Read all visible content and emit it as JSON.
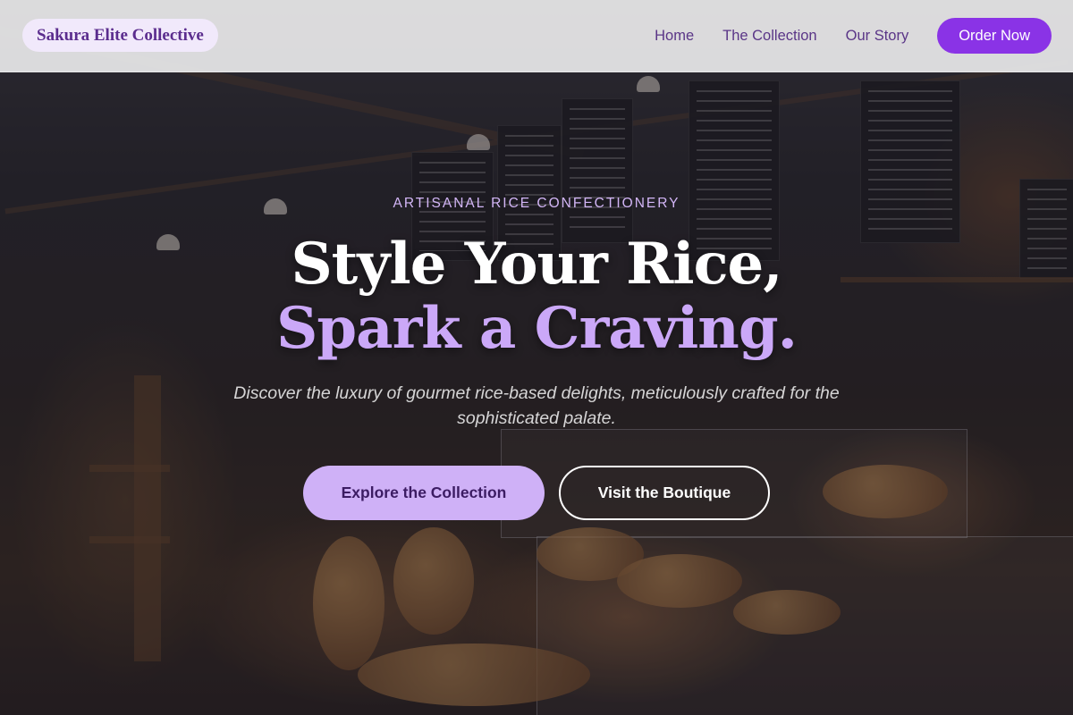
{
  "header": {
    "logo_text": "Sakura Elite Collective",
    "nav": {
      "home": "Home",
      "collection": "The Collection",
      "story": "Our Story"
    },
    "cta": "Order Now"
  },
  "hero": {
    "eyebrow": "ARTISANAL RICE CONFECTIONERY",
    "title_line1": "Style Your Rice,",
    "title_line2": "Spark a Craving.",
    "subtitle": "Discover the luxury of gourmet rice-based delights, meticulously crafted for the sophisticated palate.",
    "primary_button": "Explore the Collection",
    "secondary_button": "Visit the Boutique",
    "background_image": "bakery-cafe-interior-photo"
  },
  "colors": {
    "accent": "#8a33e6",
    "accent_light": "#cfb1f7",
    "logo_text": "#5b2d8e",
    "nav_text": "#5a3587",
    "title_highlight": "#cba8f8"
  }
}
